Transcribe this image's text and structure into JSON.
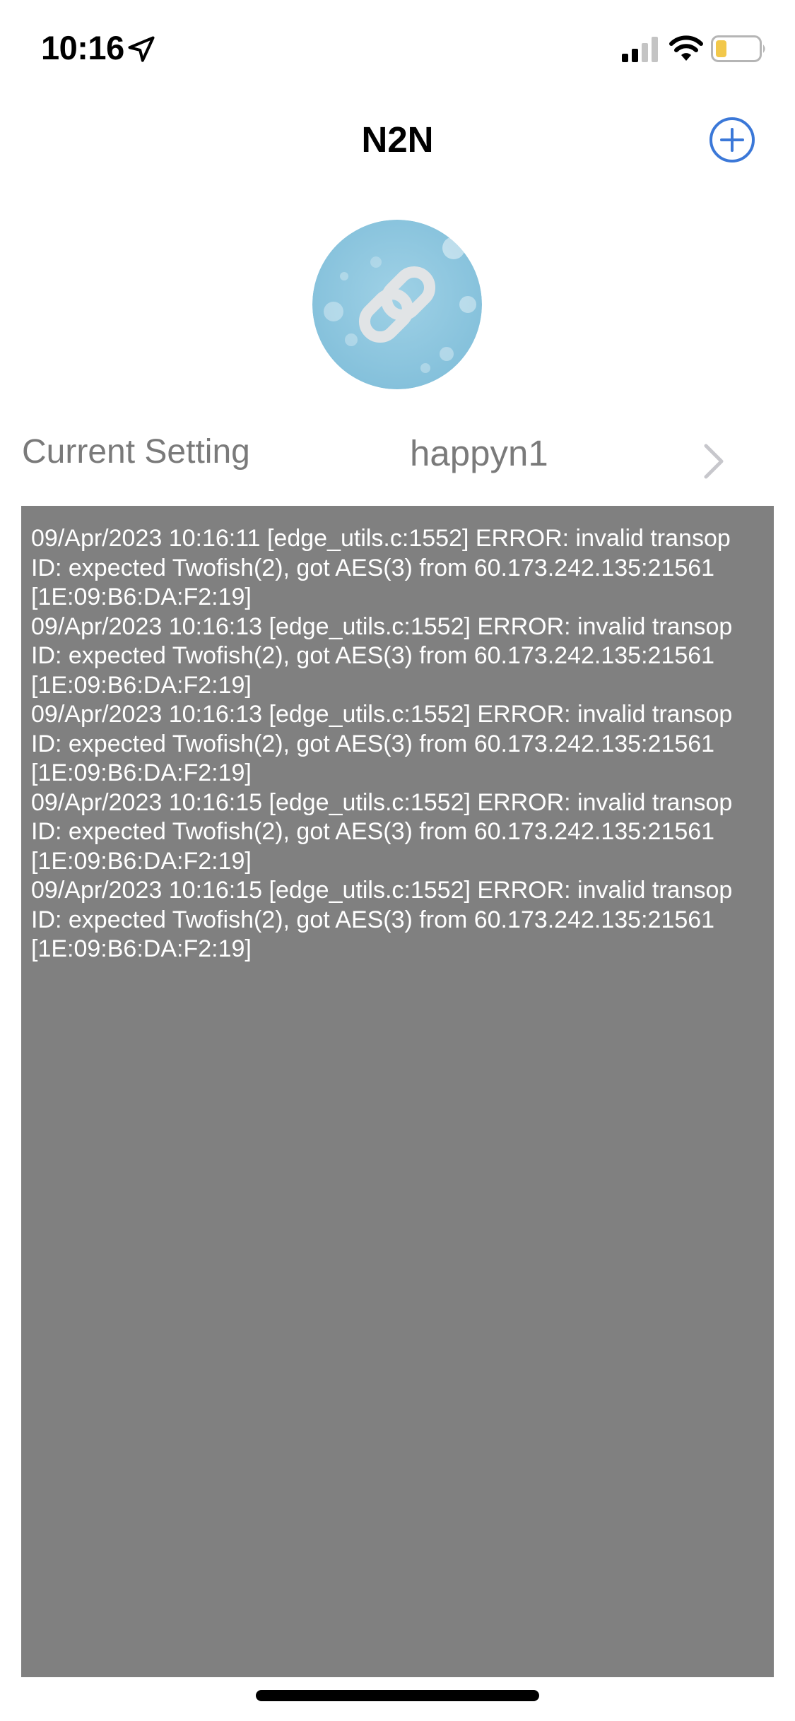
{
  "status_bar": {
    "time": "10:16",
    "icons": [
      "location-arrow-icon",
      "cellular-signal-icon",
      "wifi-icon",
      "battery-low-icon"
    ],
    "battery_color": "#f2c84b"
  },
  "nav": {
    "title": "N2N",
    "add_icon": "plus-circle-icon",
    "accent": "#3b78d8"
  },
  "avatar": {
    "icon": "link-chain-icon",
    "background": "#8ec7df"
  },
  "setting": {
    "label": "Current Setting",
    "value": "happyn1",
    "chevron_icon": "chevron-right-icon"
  },
  "log": {
    "background": "#808080",
    "lines": [
      "09/Apr/2023 10:16:11 [edge_utils.c:1552] ERROR: invalid transop ID: expected Twofish(2), got AES(3) from 60.173.242.135:21561 [1E:09:B6:DA:F2:19]",
      "09/Apr/2023 10:16:13 [edge_utils.c:1552] ERROR: invalid transop ID: expected Twofish(2), got AES(3) from 60.173.242.135:21561 [1E:09:B6:DA:F2:19]",
      "09/Apr/2023 10:16:13 [edge_utils.c:1552] ERROR: invalid transop ID: expected Twofish(2), got AES(3) from 60.173.242.135:21561 [1E:09:B6:DA:F2:19]",
      "09/Apr/2023 10:16:15 [edge_utils.c:1552] ERROR: invalid transop ID: expected Twofish(2), got AES(3) from 60.173.242.135:21561 [1E:09:B6:DA:F2:19]",
      "09/Apr/2023 10:16:15 [edge_utils.c:1552] ERROR: invalid transop ID: expected Twofish(2), got AES(3) from 60.173.242.135:21561 [1E:09:B6:DA:F2:19]"
    ]
  }
}
